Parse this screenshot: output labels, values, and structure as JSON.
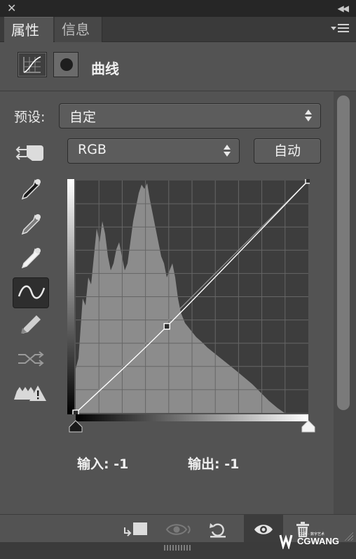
{
  "window": {
    "close_glyph": "✕",
    "collapse_glyph": "◀◀"
  },
  "tabs": [
    {
      "label": "属性",
      "active": true
    },
    {
      "label": "信息",
      "active": false
    }
  ],
  "adjustment": {
    "title": "曲线",
    "icons": [
      "curves-adjustment-icon",
      "layer-mask-icon"
    ]
  },
  "preset": {
    "label": "预设:",
    "value": "自定"
  },
  "channel": {
    "value": "RGB"
  },
  "auto_button": "自动",
  "tools": [
    "on-image-adjust-icon",
    "black-point-eyedropper-icon",
    "gray-point-eyedropper-icon",
    "white-point-eyedropper-icon",
    "curve-points-icon",
    "pencil-draw-icon",
    "smooth-curve-icon",
    "clipping-warning-icon"
  ],
  "selected_tool": "curve-points-icon",
  "curve": {
    "input_label": "输入:",
    "input_value": "-1",
    "output_label": "输出:",
    "output_value": "-1",
    "points": [
      [
        -1,
        -1
      ],
      [
        100,
        95
      ],
      [
        255,
        255
      ]
    ]
  },
  "bottom_icons": [
    "clip-to-layer-icon",
    "view-previous-state-icon",
    "reset-adjustments-icon",
    "toggle-visibility-icon",
    "delete-adjustment-icon"
  ],
  "watermark": {
    "text": "CGWANG",
    "subtext": "CG网 · 数字艺术"
  },
  "colors": {
    "panel_bg": "#535353",
    "graph_bg": "#3d3d3d",
    "histogram": "#8c8c8c",
    "curve": "#ffffff"
  }
}
